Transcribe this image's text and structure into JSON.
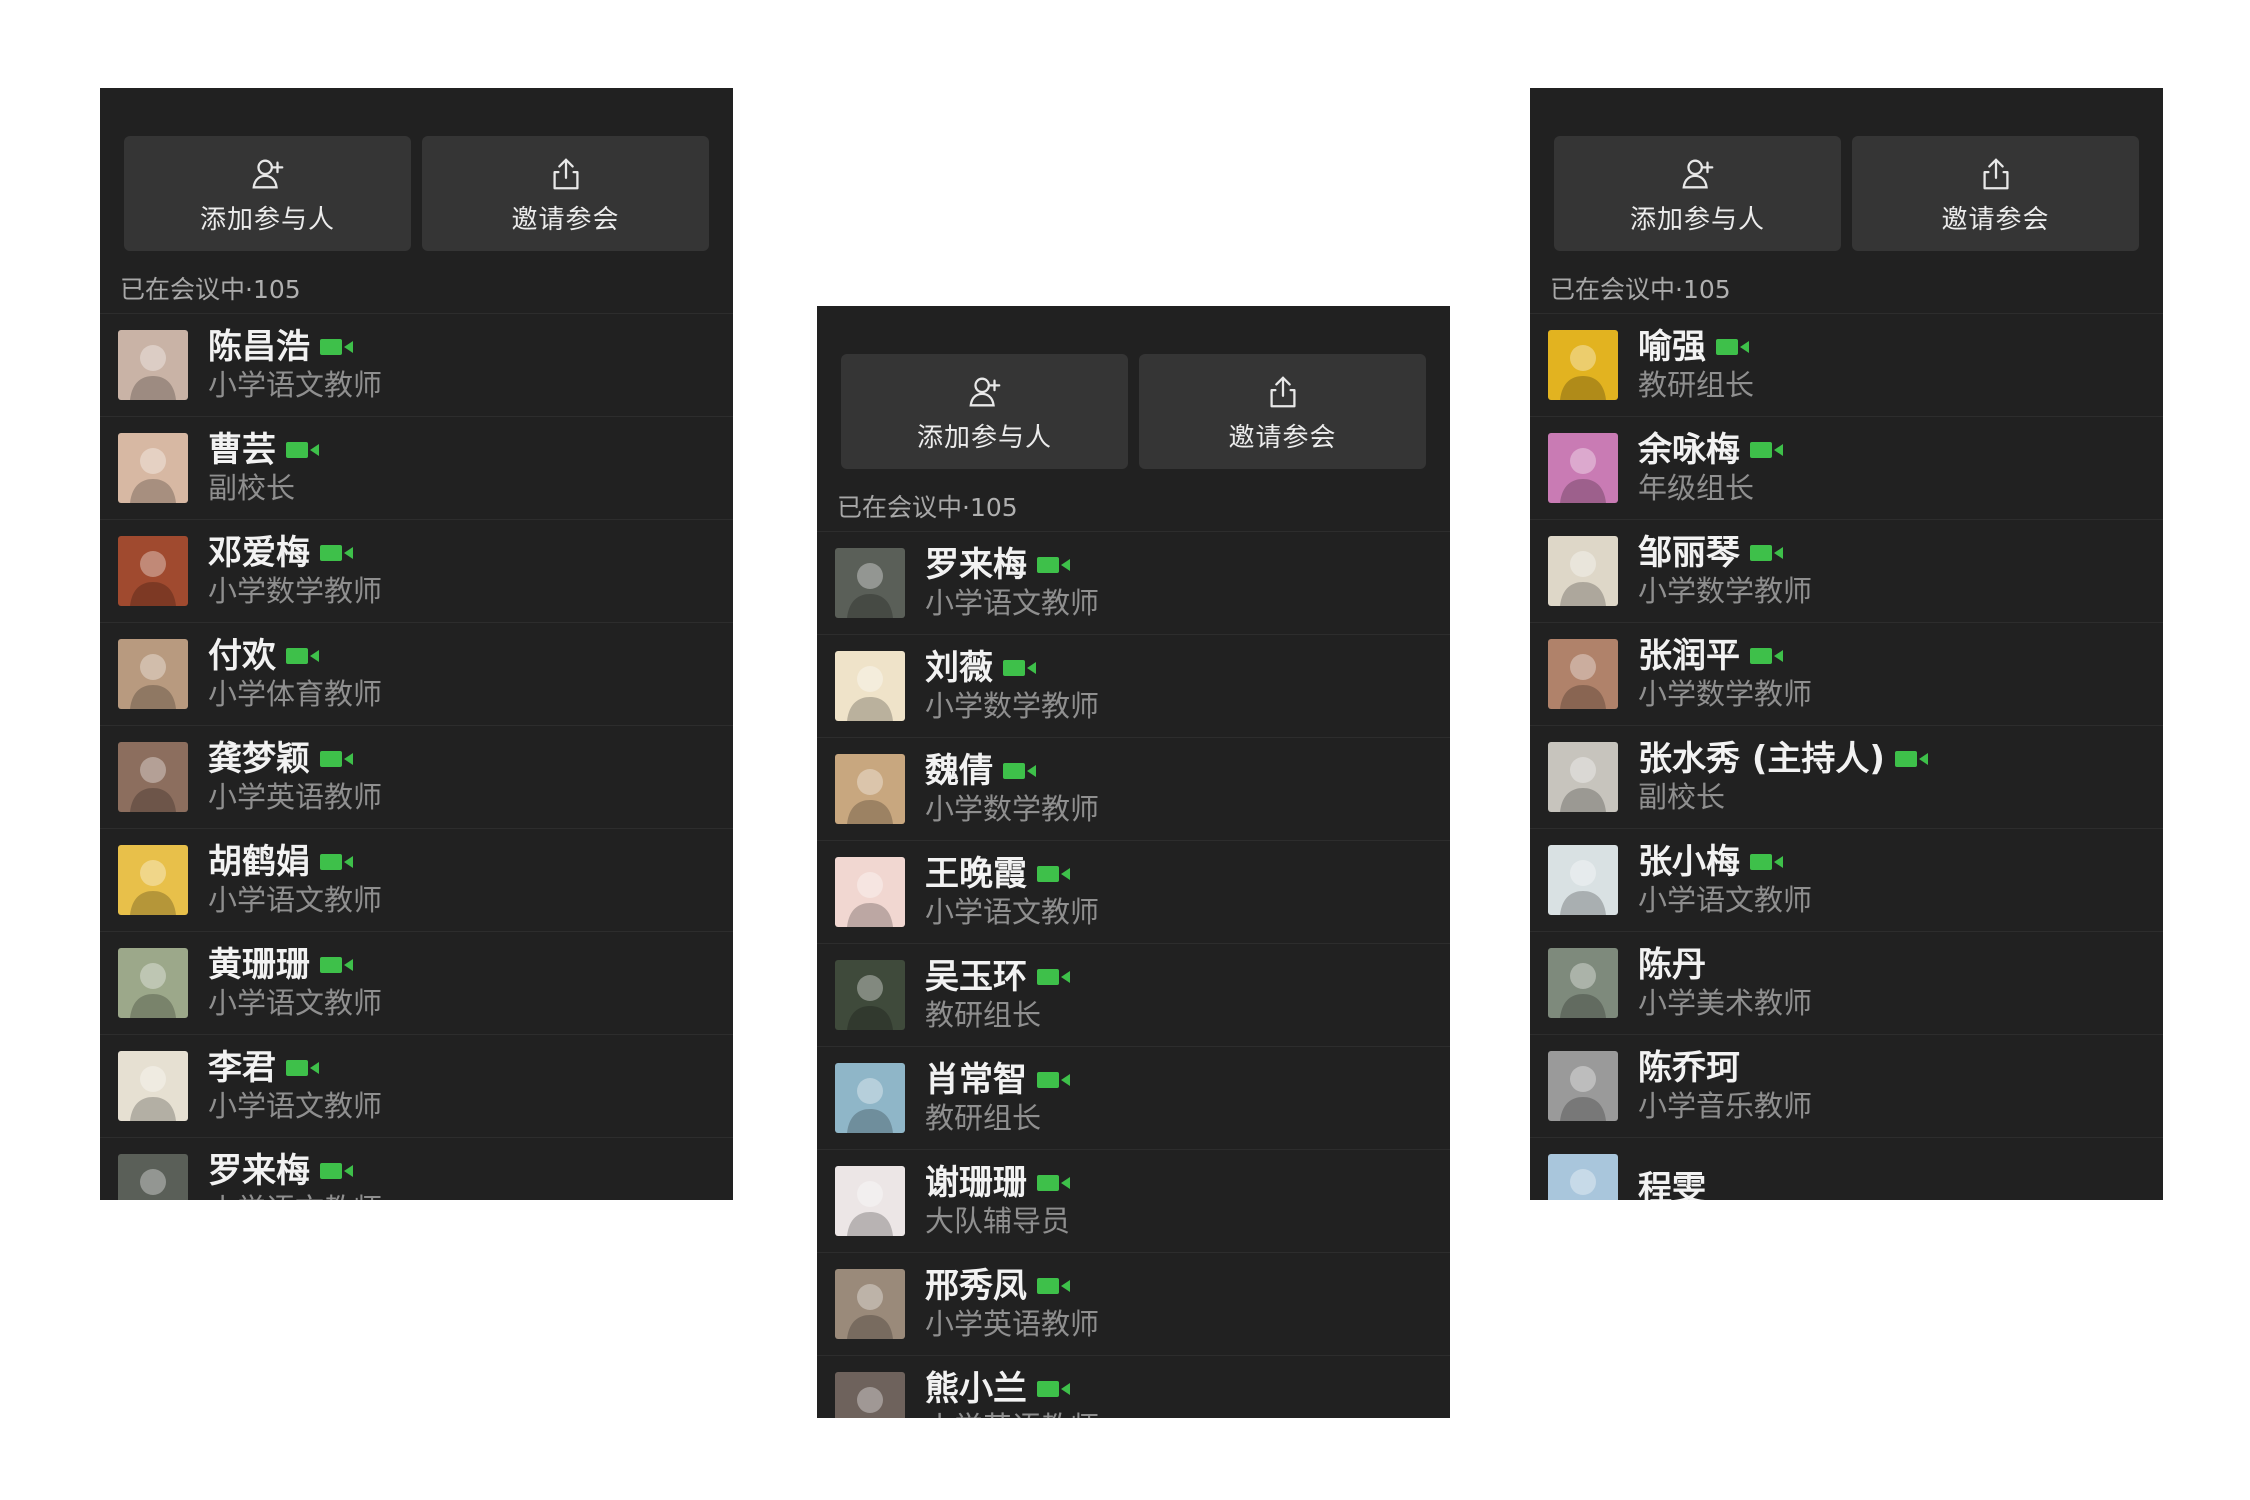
{
  "panels": [
    {
      "add_label": "添加参与人",
      "invite_label": "邀请参会",
      "section_label": "已在会议中",
      "section_count": "·105",
      "participants": [
        {
          "name": "陈昌浩",
          "role": "小学语文教师",
          "video_on": true,
          "avatar_color": "#c9b3a6"
        },
        {
          "name": "曹芸",
          "role": "副校长",
          "video_on": true,
          "avatar_color": "#d7b8a3"
        },
        {
          "name": "邓爱梅",
          "role": "小学数学教师",
          "video_on": true,
          "avatar_color": "#a04a2f"
        },
        {
          "name": "付欢",
          "role": "小学体育教师",
          "video_on": true,
          "avatar_color": "#b89a7f"
        },
        {
          "name": "龚梦颖",
          "role": "小学英语教师",
          "video_on": true,
          "avatar_color": "#8c6e5e"
        },
        {
          "name": "胡鹤娟",
          "role": "小学语文教师",
          "video_on": true,
          "avatar_color": "#e8c04a"
        },
        {
          "name": "黄珊珊",
          "role": "小学语文教师",
          "video_on": true,
          "avatar_color": "#9ca88a"
        },
        {
          "name": "李君",
          "role": "小学语文教师",
          "video_on": true,
          "avatar_color": "#e6e0d2"
        },
        {
          "name": "罗来梅",
          "role": "小学语文教师",
          "video_on": true,
          "avatar_color": "#5a5f58"
        }
      ]
    },
    {
      "add_label": "添加参与人",
      "invite_label": "邀请参会",
      "section_label": "已在会议中",
      "section_count": "·105",
      "participants": [
        {
          "name": "罗来梅",
          "role": "小学语文教师",
          "video_on": true,
          "avatar_color": "#5a5f58"
        },
        {
          "name": "刘薇",
          "role": "小学数学教师",
          "video_on": true,
          "avatar_color": "#efe3c9"
        },
        {
          "name": "魏倩",
          "role": "小学数学教师",
          "video_on": true,
          "avatar_color": "#c8a77f"
        },
        {
          "name": "王晚霞",
          "role": "小学语文教师",
          "video_on": true,
          "avatar_color": "#f1d7d1"
        },
        {
          "name": "吴玉环",
          "role": "教研组长",
          "video_on": true,
          "avatar_color": "#3f4a3b"
        },
        {
          "name": "肖常智",
          "role": "教研组长",
          "video_on": true,
          "avatar_color": "#8fb6c8"
        },
        {
          "name": "谢珊珊",
          "role": "大队辅导员",
          "video_on": true,
          "avatar_color": "#ece6e6"
        },
        {
          "name": "邢秀凤",
          "role": "小学英语教师",
          "video_on": true,
          "avatar_color": "#9a8a7a"
        },
        {
          "name": "熊小兰",
          "role": "小学英语教师",
          "video_on": true,
          "avatar_color": "#6e625c"
        }
      ]
    },
    {
      "add_label": "添加参与人",
      "invite_label": "邀请参会",
      "section_label": "已在会议中",
      "section_count": "·105",
      "participants": [
        {
          "name": "喻强",
          "role": "教研组长",
          "video_on": true,
          "avatar_color": "#e2b320"
        },
        {
          "name": "余咏梅",
          "role": "年级组长",
          "video_on": true,
          "avatar_color": "#c97bb4"
        },
        {
          "name": "邹丽琴",
          "role": "小学数学教师",
          "video_on": true,
          "avatar_color": "#ded7c8"
        },
        {
          "name": "张润平",
          "role": "小学数学教师",
          "video_on": true,
          "avatar_color": "#b0826a"
        },
        {
          "name": "张水秀 (主持人)",
          "role": "副校长",
          "video_on": true,
          "avatar_color": "#c7c4bd"
        },
        {
          "name": "张小梅",
          "role": "小学语文教师",
          "video_on": true,
          "avatar_color": "#d9e1e3"
        },
        {
          "name": "陈丹",
          "role": "小学美术教师",
          "video_on": false,
          "avatar_color": "#7e8a7c"
        },
        {
          "name": "陈乔珂",
          "role": "小学音乐教师",
          "video_on": false,
          "avatar_color": "#9a9a9a"
        },
        {
          "name": "程雯",
          "role": "",
          "video_on": false,
          "avatar_color": "#a9c6dc"
        }
      ]
    }
  ],
  "colors": {
    "panel_bg": "#212121",
    "button_bg": "#353535",
    "camera_green": "#3ec04a",
    "name_text": "#f2f2f2",
    "role_text": "#8f8f8f"
  }
}
